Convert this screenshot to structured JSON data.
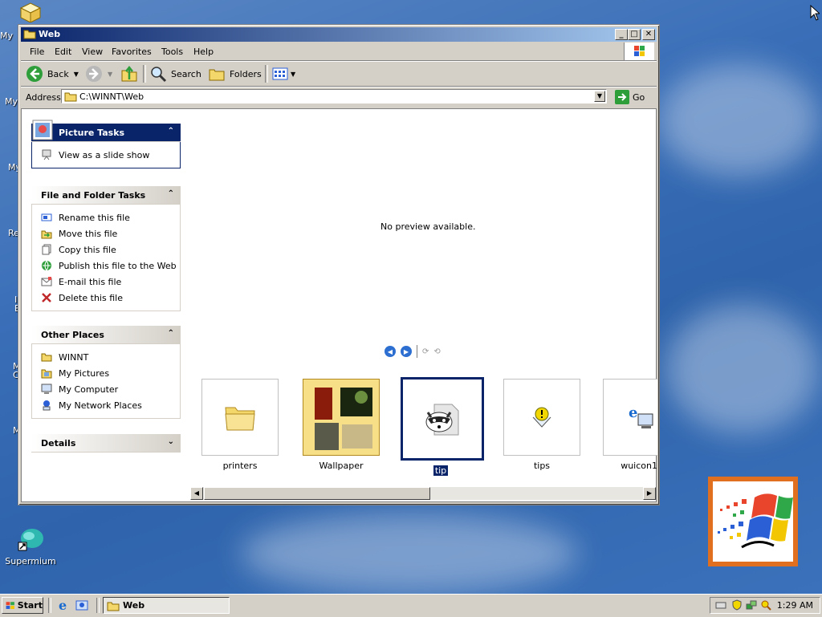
{
  "desktop": {
    "icons": [
      {
        "label": "Supermium"
      }
    ],
    "partial_labels": [
      "My",
      "My",
      "My",
      "Re",
      "I",
      "E",
      "M",
      "C",
      "M"
    ]
  },
  "window": {
    "title": "Web",
    "buttons": {
      "minimize": "_",
      "maximize": "□",
      "close": "✕"
    }
  },
  "menu": [
    "File",
    "Edit",
    "View",
    "Favorites",
    "Tools",
    "Help"
  ],
  "toolbar": {
    "back": "Back",
    "search": "Search",
    "folders": "Folders"
  },
  "address": {
    "label": "Address",
    "value": "C:\\WINNT\\Web",
    "go": "Go"
  },
  "side": {
    "picture_tasks": {
      "title": "Picture Tasks",
      "items": [
        "View as a slide show"
      ]
    },
    "file_folder_tasks": {
      "title": "File and Folder Tasks",
      "items": [
        "Rename this file",
        "Move this file",
        "Copy this file",
        "Publish this file to the Web",
        "E-mail this file",
        "Delete this file"
      ]
    },
    "other_places": {
      "title": "Other Places",
      "items": [
        "WINNT",
        "My Pictures",
        "My Computer",
        "My Network Places"
      ]
    },
    "details": {
      "title": "Details"
    }
  },
  "preview": {
    "message": "No preview available."
  },
  "files": [
    {
      "name": "printers",
      "icon": "folder-icon"
    },
    {
      "name": "Wallpaper",
      "icon": "folder-thumbnail-icon"
    },
    {
      "name": "tip",
      "icon": "raccoon-file-icon",
      "selected": true
    },
    {
      "name": "tips",
      "icon": "tips-html-icon"
    },
    {
      "name": "wuicon1",
      "icon": "ie-computer-icon"
    }
  ],
  "taskbar": {
    "start": "Start",
    "task": "Web",
    "clock": "1:29 AM"
  },
  "colors": {
    "titlebar_start": "#0a246a",
    "titlebar_end": "#a6caf0",
    "face": "#d4d0c8",
    "desktop": "#3a6fb8",
    "selection": "#0a246a"
  }
}
